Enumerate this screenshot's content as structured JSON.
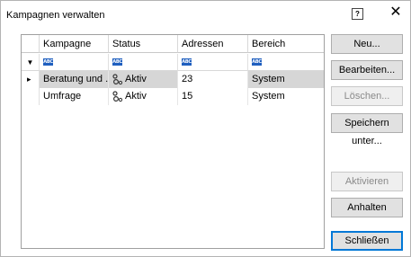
{
  "dialog": {
    "title": "Kampagnen verwalten",
    "help_glyph": "?",
    "close_glyph": "✕"
  },
  "grid": {
    "columns": [
      "Kampagne",
      "Status",
      "Adressen",
      "Bereich"
    ],
    "filter_glyph": "▼",
    "filter_icon_text": "ABC",
    "row_marker": "▸",
    "rows": [
      {
        "kampagne": "Beratung und ...",
        "status": "Aktiv",
        "adressen": "23",
        "bereich": "System",
        "selected": true
      },
      {
        "kampagne": "Umfrage",
        "status": "Aktiv",
        "adressen": "15",
        "bereich": "System",
        "selected": false
      }
    ]
  },
  "buttons": {
    "neu": "Neu...",
    "bearbeiten": "Bearbeiten...",
    "loeschen": "Löschen...",
    "speichern": "Speichern unter...",
    "aktivieren": "Aktivieren",
    "anhalten": "Anhalten",
    "schliessen": "Schließen"
  },
  "colors": {
    "accent": "#0078d7",
    "selected_row": "#d6d6d6",
    "filter_icon": "#1f5fbf"
  }
}
